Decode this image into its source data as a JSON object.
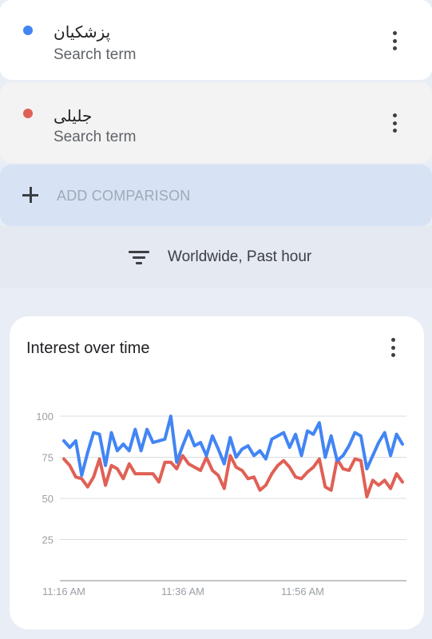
{
  "terms": [
    {
      "name": "پزشکیان",
      "subtitle": "Search term",
      "color": "#4285f4"
    },
    {
      "name": "جلیلی",
      "subtitle": "Search term",
      "color": "#e06055"
    }
  ],
  "add_comparison_label": "ADD COMPARISON",
  "filter": {
    "label": "Worldwide, Past hour"
  },
  "chart_card": {
    "title": "Interest over time"
  },
  "chart_data": {
    "type": "line",
    "title": "Interest over time",
    "x_tick_labels": [
      "11:16 AM",
      "11:36 AM",
      "11:56 AM"
    ],
    "y_ticks": [
      25,
      50,
      75,
      100
    ],
    "ylim": [
      0,
      100
    ],
    "grid": true,
    "series": [
      {
        "name": "پزشکیان",
        "color": "#4285f4",
        "values": [
          85,
          81,
          85,
          64,
          78,
          90,
          89,
          70,
          90,
          79,
          83,
          79,
          92,
          79,
          92,
          84,
          85,
          86,
          100,
          72,
          82,
          91,
          82,
          84,
          76,
          88,
          80,
          71,
          87,
          75,
          80,
          82,
          76,
          79,
          74,
          86,
          88,
          90,
          81,
          89,
          76,
          91,
          89,
          96,
          75,
          88,
          73,
          76,
          82,
          90,
          88,
          68,
          76,
          84,
          90,
          76,
          89,
          83
        ]
      },
      {
        "name": "جلیلی",
        "color": "#e06055",
        "values": [
          74,
          70,
          63,
          62,
          57,
          63,
          74,
          58,
          70,
          68,
          62,
          71,
          65,
          65,
          65,
          65,
          60,
          72,
          72,
          68,
          76,
          71,
          69,
          67,
          75,
          67,
          64,
          56,
          76,
          69,
          67,
          62,
          63,
          55,
          58,
          65,
          70,
          73,
          69,
          63,
          62,
          66,
          69,
          74,
          57,
          55,
          74,
          68,
          67,
          74,
          73,
          51,
          61,
          58,
          61,
          56,
          65,
          60
        ]
      }
    ]
  }
}
